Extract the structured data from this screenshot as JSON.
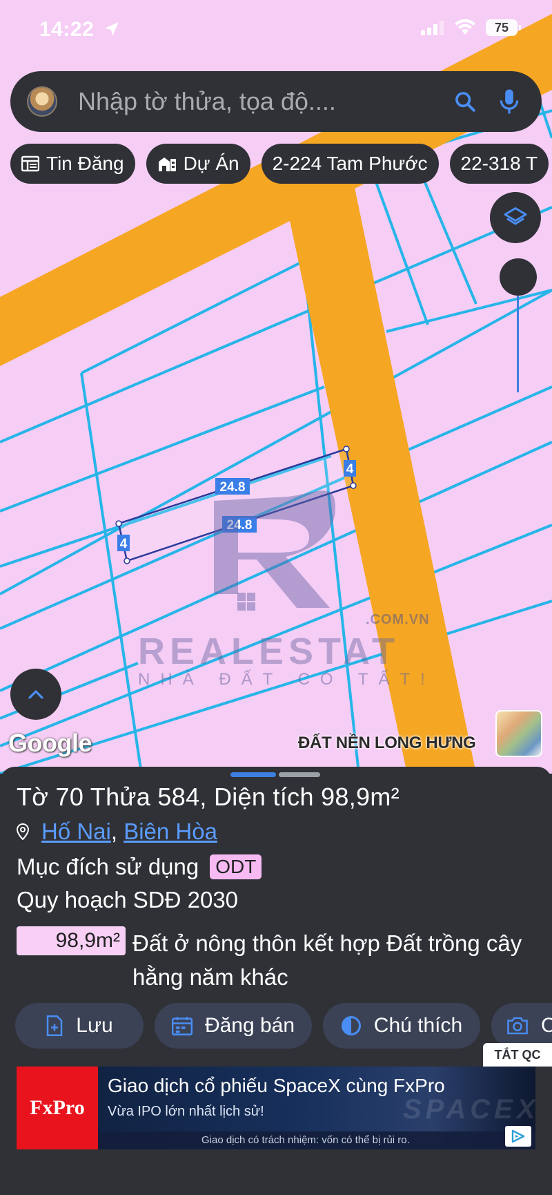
{
  "status_bar": {
    "time": "14:22",
    "battery": "75"
  },
  "search": {
    "placeholder": "Nhập tờ thửa, tọa độ...."
  },
  "chips": [
    {
      "label": "Tin Đăng",
      "icon": "newspaper-icon"
    },
    {
      "label": "Dự Án",
      "icon": "building-icon"
    },
    {
      "label": "2-224 Tam Phước",
      "icon": ""
    },
    {
      "label": "22-318 T",
      "icon": ""
    }
  ],
  "map": {
    "dimension_labels": {
      "top_edge": "24.8",
      "bottom_edge": "24.8",
      "left_edge": "4",
      "right_edge": "4"
    },
    "watermark": {
      "domain": ".COM.VN",
      "brand": "REALESTAT",
      "tagline": "NHÀ ĐẤT CÓ TẤT!"
    },
    "google_label": "Google",
    "caption": "ĐẤT NỀN LONG HƯNG",
    "colors": {
      "land": "#f6cdf5",
      "road": "#f5a623",
      "parcel_line": "#27b5e8"
    }
  },
  "parcel": {
    "title": "Tờ 70 Thửa 584, Diện tích 98,9m²",
    "ward": "Hố Nai",
    "separator": ", ",
    "city": "Biên Hòa",
    "purpose_label": "Mục đích sử dụng",
    "purpose_code": "ODT",
    "plan_title": "Quy hoạch SDĐ 2030",
    "plan_area": "98,9m²",
    "plan_desc": "Đất ở nông thôn kết hợp Đất trồng cây hằng năm khác"
  },
  "actions": [
    {
      "label": "Lưu",
      "icon": "file-add-icon"
    },
    {
      "label": "Đăng bán",
      "icon": "calendar-icon"
    },
    {
      "label": "Chú thích",
      "icon": "contrast-icon"
    },
    {
      "label": "C",
      "icon": "camera-icon"
    }
  ],
  "ad": {
    "close_label": "TẮT QC",
    "brand": "FxPro",
    "title": "Giao dịch cổ phiếu SpaceX cùng FxPro",
    "subtitle": "Vừa IPO lớn nhất lịch sử!",
    "footer": "Giao dịch có trách nhiệm: vốn có thể bị rủi ro.",
    "deco": "SPACEX"
  }
}
